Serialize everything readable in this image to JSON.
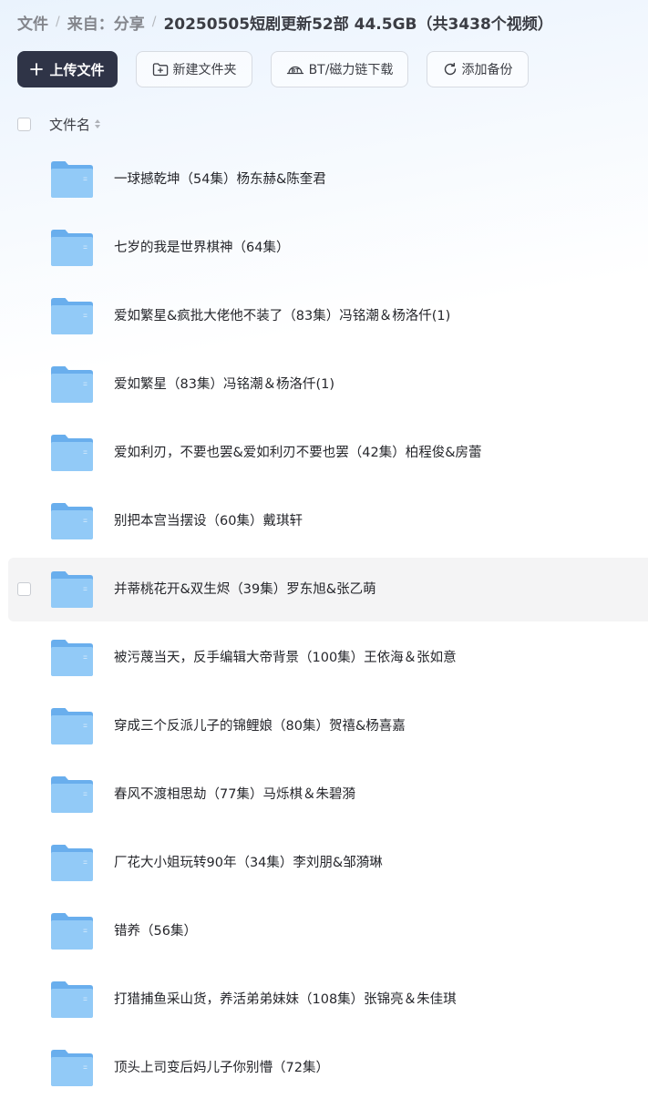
{
  "breadcrumb": {
    "root": "文件",
    "parent": "来自：分享",
    "current": "20250505短剧更新52部 44.5GB（共3438个视频）"
  },
  "toolbar": {
    "upload_label": "上传文件",
    "new_folder_label": "新建文件夹",
    "bt_label": "BT/磁力链下载",
    "backup_label": "添加备份"
  },
  "list_header": {
    "name_label": "文件名"
  },
  "files": [
    {
      "name": "一球撼乾坤（54集）杨东赫&陈奎君"
    },
    {
      "name": "七岁的我是世界棋神（64集）"
    },
    {
      "name": "爱如繁星&疯批大佬他不装了（83集）冯铭潮＆杨洛仟(1)"
    },
    {
      "name": "爱如繁星（83集）冯铭潮＆杨洛仟(1)"
    },
    {
      "name": "爱如利刃，不要也罢&爱如利刃不要也罢（42集）柏程俊&房蕾"
    },
    {
      "name": "别把本宫当摆设（60集）戴琪轩"
    },
    {
      "name": "并蒂桃花开&双生烬（39集）罗东旭&张乙萌"
    },
    {
      "name": "被污蔑当天，反手编辑大帝背景（100集）王依海＆张如意"
    },
    {
      "name": "穿成三个反派儿子的锦鲤娘（80集）贺禧&杨喜嘉"
    },
    {
      "name": "春风不渡相思劫（77集）马烁棋＆朱碧漪"
    },
    {
      "name": "厂花大小姐玩转90年（34集）李刘朋&邹漪琳"
    },
    {
      "name": "错养（56集）"
    },
    {
      "name": "打猎捕鱼采山货，养活弟弟妹妹（108集）张锦亮＆朱佳琪"
    },
    {
      "name": "顶头上司变后妈儿子你别懵（72集）"
    }
  ],
  "hovered_index": 6,
  "colors": {
    "primary_button": "#2f3447",
    "folder_back": "#69aeed",
    "folder_front": "#92caf7",
    "hover_row": "#f4f4f5"
  }
}
